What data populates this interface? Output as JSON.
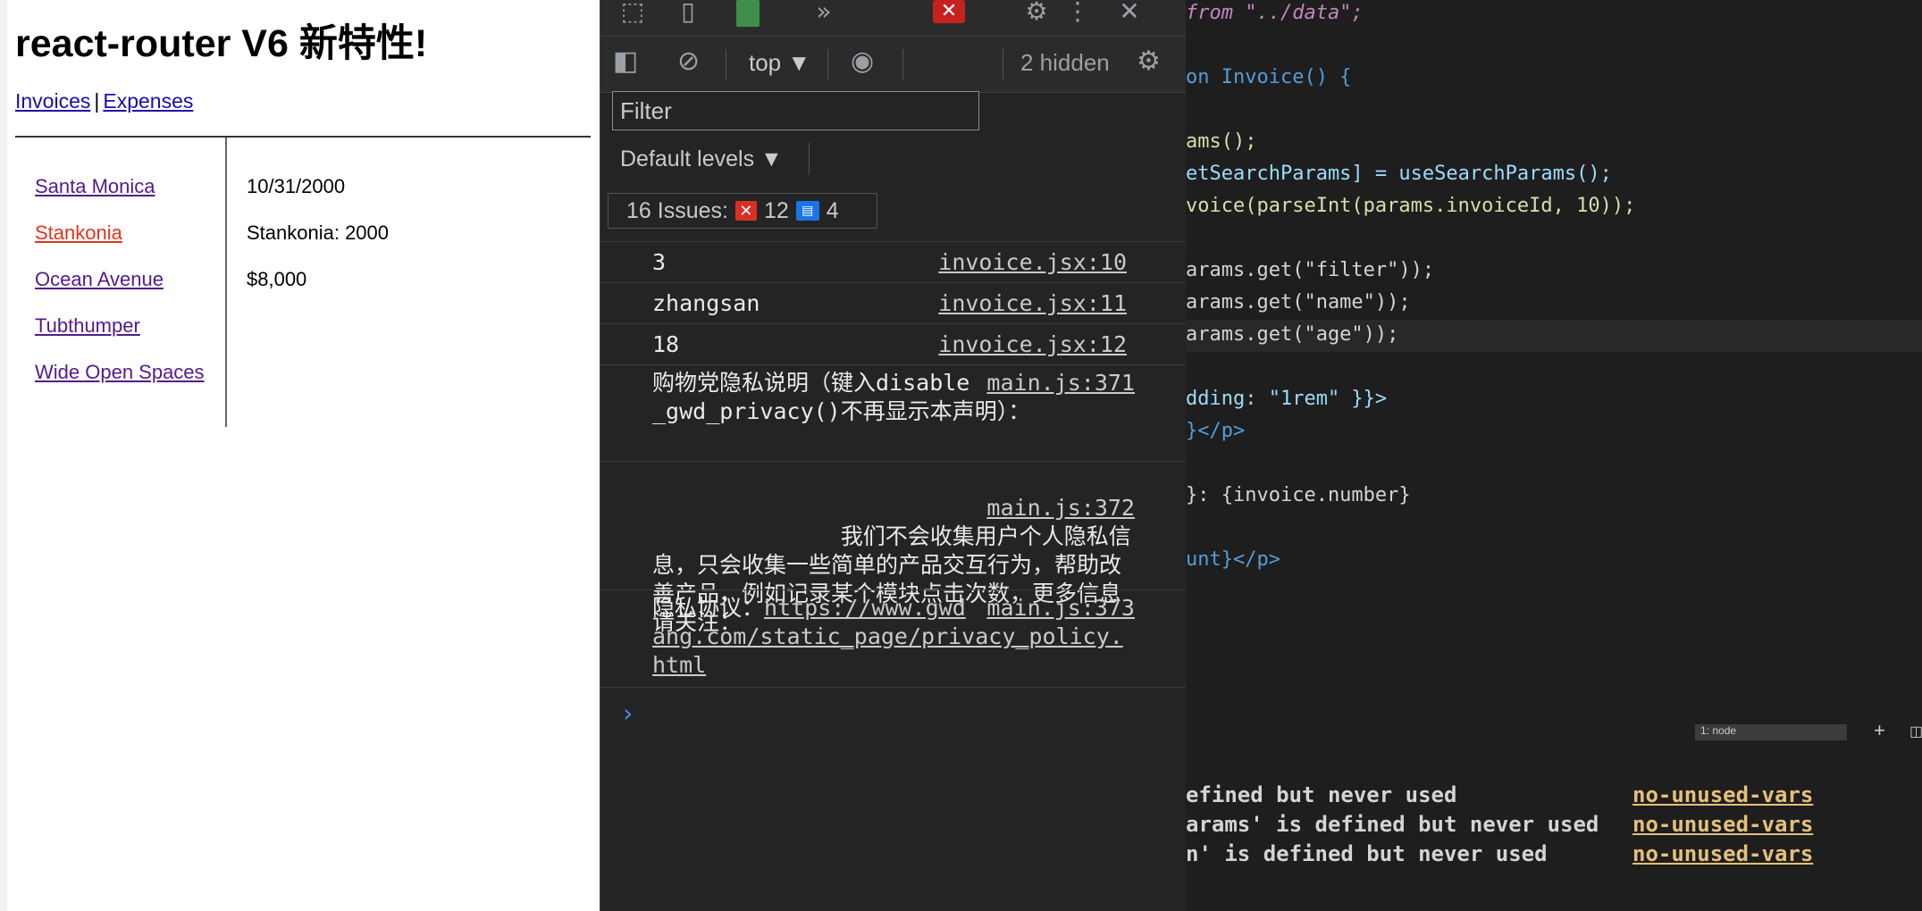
{
  "page": {
    "title": "react-router V6 新特性!",
    "nav": {
      "invoices": "Invoices",
      "sep": "|",
      "expenses": "Expenses"
    },
    "invoices": [
      {
        "name": "Santa Monica",
        "active": false
      },
      {
        "name": "Stankonia",
        "active": true
      },
      {
        "name": "Ocean Avenue",
        "active": false
      },
      {
        "name": "Tubthumper",
        "active": false
      },
      {
        "name": "Wide Open Spaces",
        "active": false
      }
    ],
    "detail": {
      "due": "10/31/2000",
      "name": "Stankonia: 2000",
      "amount": "$8,000"
    }
  },
  "devtools": {
    "context": "top",
    "hidden": "2 hidden",
    "filter_placeholder": "Filter",
    "levels": "Default levels",
    "issues": {
      "label": "16 Issues:",
      "errors": "12",
      "info": "4"
    },
    "logs": [
      {
        "msg": "3",
        "src": "invoice.jsx:10"
      },
      {
        "msg": "zhangsan",
        "src": "invoice.jsx:11"
      },
      {
        "msg": "18",
        "src": "invoice.jsx:12"
      },
      {
        "msg": "购物党隐私说明（键入disable_gwd_privacy()不再显示本声明）：",
        "src": "main.js:371"
      },
      {
        "msg": "      我们不会收集用户个人隐私信息，只会收集一些简单的产品交互行为，帮助改善产品，例如记录某个模块点击次数，更多信息请关注：",
        "src": "main.js:372"
      },
      {
        "msg_prefix": "隐私协议：",
        "link": "https://www.gwdang.com/static_page/privacy_policy.html",
        "src": "main.js:373"
      }
    ],
    "prompt": "›"
  },
  "editor": {
    "lines": [
      "from \"../data\";",
      "on Invoice() {",
      "ams();",
      "etSearchParams] = useSearchParams();",
      "voice(parseInt(params.invoiceId, 10));",
      "arams.get(\"filter\"));",
      "arams.get(\"name\"));",
      "arams.get(\"age\"));",
      "dding: \"1rem\" }}>",
      "}</p>",
      "}: {invoice.number}",
      "unt}</p>"
    ],
    "terminal_select": "1: node",
    "warnings": [
      {
        "text": "efined but never used",
        "rule": "no-unused-vars"
      },
      {
        "text": "arams' is defined but never used",
        "rule": "no-unused-vars"
      },
      {
        "text": "n' is defined but never used",
        "rule": "no-unused-vars"
      }
    ]
  }
}
